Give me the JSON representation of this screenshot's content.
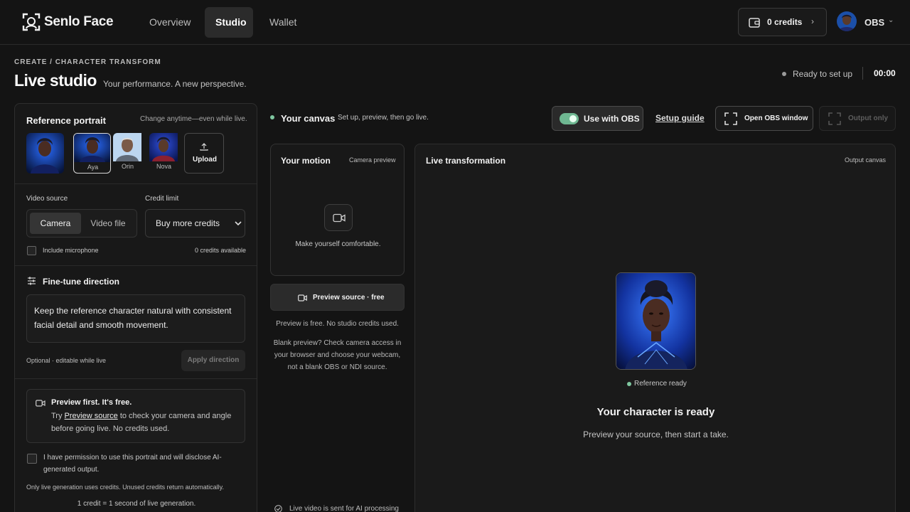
{
  "nav": {
    "brand": "Senlo Face",
    "tabs": [
      "Overview",
      "Studio",
      "Wallet"
    ],
    "active_tab": "Studio",
    "credits_label": "0 credits",
    "user_name": "OBS"
  },
  "header": {
    "breadcrumb": "CREATE / CHARACTER TRANSFORM",
    "title": "Live studio",
    "subtitle": "Your performance. A new perspective.",
    "status": "Ready to set up",
    "timer": "00:00"
  },
  "reference": {
    "heading": "Reference portrait",
    "hint": "Change anytime—even while live.",
    "portraits": [
      {
        "name": ""
      },
      {
        "name": "Aya"
      },
      {
        "name": "Orin"
      },
      {
        "name": "Nova"
      }
    ],
    "upload_label": "Upload"
  },
  "video": {
    "source_label": "Video source",
    "camera_label": "Camera",
    "file_label": "Video file",
    "credit_limit_label": "Credit limit",
    "credit_select_value": "Buy more credits",
    "mic_label": "Include microphone",
    "credits_available": "0 credits available"
  },
  "direction": {
    "heading": "Fine-tune direction",
    "text": "Keep the reference character natural with consistent facial detail and smooth movement.",
    "optional_note": "Optional · editable while live",
    "apply_label": "Apply direction"
  },
  "tip": {
    "title": "Preview first. It's free.",
    "prefix": "Try",
    "link": "Preview source",
    "suffix_line1": "to check your camera and angle",
    "line2": "before going live. No credits used."
  },
  "permission": {
    "line1": "I have permission to use this portrait and will disclose AI-",
    "line2": "generated output.",
    "note": "Only live generation uses credits. Unused credits return automatically.",
    "rate": "1 credit = 1 second of live generation."
  },
  "canvas": {
    "title": "Your canvas",
    "subtitle": "Set up, preview, then go live.",
    "obs_toggle_label": "Use with OBS",
    "setup_guide": "Setup guide",
    "open_obs": "Open OBS window",
    "output_only": "Output only"
  },
  "motion": {
    "title": "Your motion",
    "tag": "Camera preview",
    "message": "Make yourself comfortable.",
    "preview_btn": "Preview source · free",
    "free_note": "Preview is free. No studio credits used.",
    "blank_help_1": "Blank preview? Check camera access in",
    "blank_help_2": "your browser and choose your webcam,",
    "blank_help_3": "not a blank OBS or NDI source.",
    "privacy": "Live video is sent for AI processing"
  },
  "live": {
    "title": "Live transformation",
    "tag": "Output canvas",
    "ref_status": "Reference ready",
    "ready_title": "Your character is ready",
    "ready_sub": "Preview your source, then start a take."
  },
  "colors": {
    "accent_green": "#6fb892",
    "background": "#141414",
    "panel": "#181818"
  }
}
